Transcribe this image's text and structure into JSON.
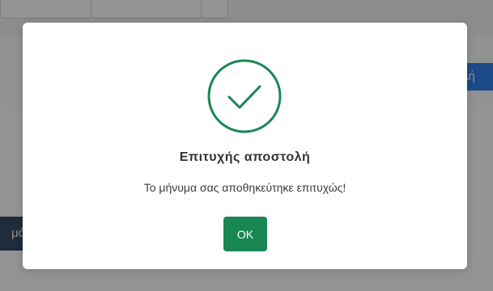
{
  "background": {
    "blue_button_label": "λή",
    "side_button_label": "μό"
  },
  "dialog": {
    "title": "Επιτυχής αποστολή",
    "message": "Το μήνυμα σας αποθηκεύτηκε επιτυχώς!",
    "ok_label": "OK",
    "icon": "check-circle-icon",
    "success_color": "#198754"
  }
}
